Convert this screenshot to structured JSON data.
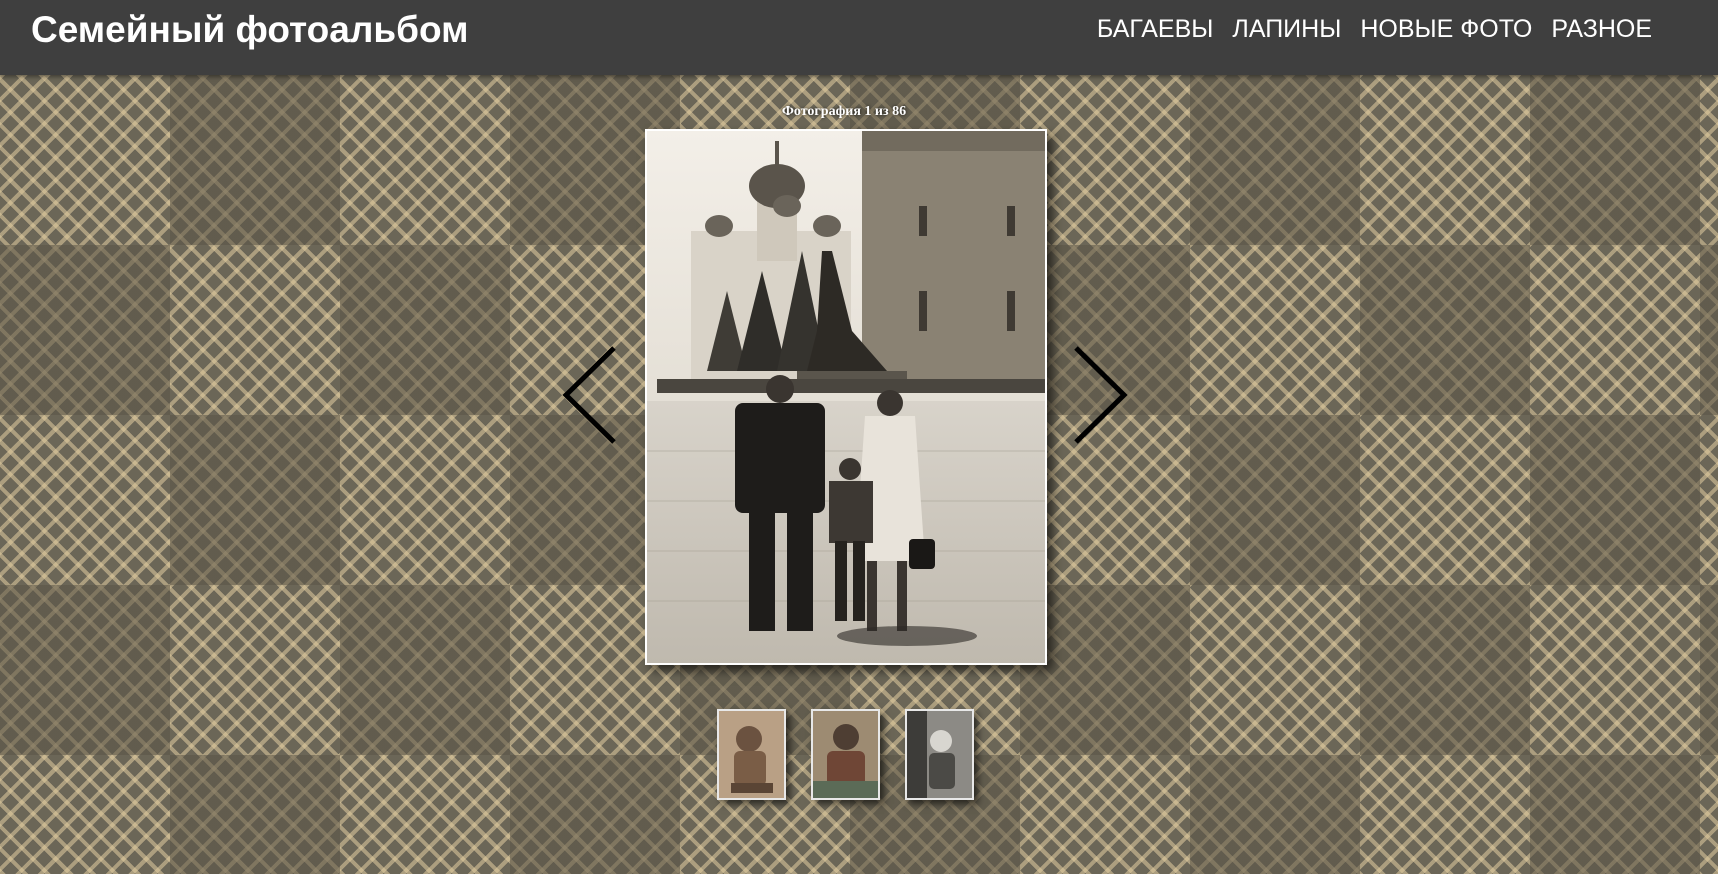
{
  "header": {
    "title": "Семейный фотоальбом",
    "nav": [
      "БАГАЕВЫ",
      "ЛАПИНЫ",
      "НОВЫЕ ФОТО",
      "РАЗНОЕ"
    ]
  },
  "gallery": {
    "counter": "Фотография 1 из 86",
    "prev_icon": "chevron-left-icon",
    "next_icon": "chevron-right-icon"
  },
  "colors": {
    "header_bg": "#3f3f3f",
    "pattern_dark": "#6b6657",
    "pattern_light": "#e2cda0"
  }
}
